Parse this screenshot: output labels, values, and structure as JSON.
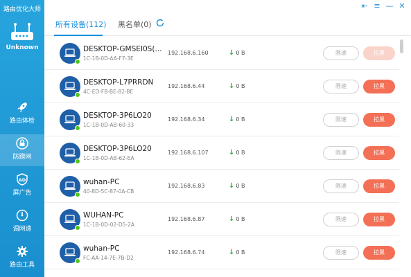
{
  "app": {
    "title": "路由优化大师",
    "router_name": "Unknown",
    "accent_color": "#1a8fdc",
    "sidebar_color": "#27a4dd"
  },
  "window_controls": [
    {
      "icon": "pin-icon",
      "glyph": "⇤"
    },
    {
      "icon": "menu-icon",
      "glyph": "≡"
    },
    {
      "icon": "minimize-icon",
      "glyph": "—"
    },
    {
      "icon": "close-icon",
      "glyph": "✕"
    }
  ],
  "sidebar": {
    "items": [
      {
        "label": "路由体检",
        "icon": "rocket-icon",
        "active": false
      },
      {
        "label": "防蹭网",
        "icon": "lock-icon",
        "active": true
      },
      {
        "label": "屏广告",
        "icon": "ad-shield-icon",
        "active": false
      },
      {
        "label": "调网速",
        "icon": "speedometer-icon",
        "active": false
      },
      {
        "label": "路由工具",
        "icon": "gear-icon",
        "active": false
      }
    ]
  },
  "tabs": [
    {
      "label": "所有设备(112)",
      "active": true
    },
    {
      "label": "黑名单(0)",
      "active": false
    }
  ],
  "actions": {
    "limit_label": "限速",
    "block_label": "拉黑"
  },
  "devices": [
    {
      "name": "DESKTOP-GMSEI0S(...",
      "mac": "1C-1B-0D-AA-F7-3E",
      "ip": "192.168.6.160",
      "speed": "0 B",
      "block_disabled": true
    },
    {
      "name": "DESKTOP-L7PRRDN",
      "mac": "4C-ED-FB-BE-82-BE",
      "ip": "192.168.6.44",
      "speed": "0 B",
      "block_disabled": false
    },
    {
      "name": "DESKTOP-3P6LO20",
      "mac": "1C-1B-0D-AB-60-33",
      "ip": "192.168.6.34",
      "speed": "0 B",
      "block_disabled": false
    },
    {
      "name": "DESKTOP-3P6LO20",
      "mac": "1C-1B-0D-AB-62-EA",
      "ip": "192.168.6.107",
      "speed": "0 B",
      "block_disabled": false
    },
    {
      "name": "wuhan-PC",
      "mac": "40-8D-5C-87-0A-CB",
      "ip": "192.168.6.83",
      "speed": "0 B",
      "block_disabled": false
    },
    {
      "name": "WUHAN-PC",
      "mac": "1C-1B-0D-02-D5-2A",
      "ip": "192.168.6.87",
      "speed": "0 B",
      "block_disabled": false
    },
    {
      "name": "wuhan-PC",
      "mac": "FC-AA-14-7E-7B-D2",
      "ip": "192.168.6.74",
      "speed": "0 B",
      "block_disabled": false
    }
  ]
}
